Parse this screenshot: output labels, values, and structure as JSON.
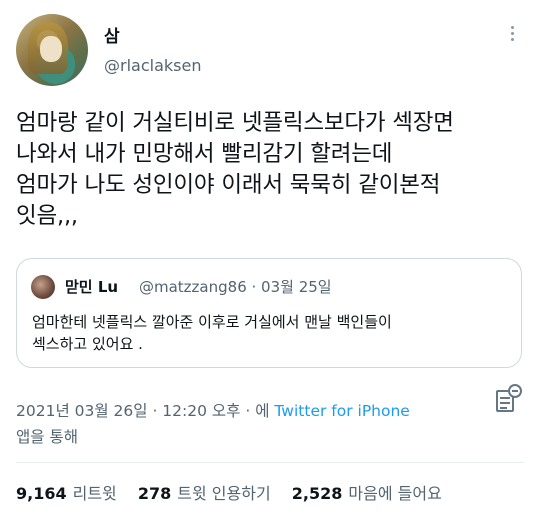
{
  "author": {
    "name": "삼",
    "handle": "@rlaclaksen"
  },
  "tweet": {
    "text": "엄마랑 같이 거실티비로 넷플릭스보다가 섹장면\n나와서 내가 민망해서 빨리감기 할려는데\n엄마가 나도 성인이야 이래서 묵묵히 같이본적\n잇음,,,"
  },
  "quoted": {
    "name": "맏민 Lu",
    "handle_date": "@matzzang86 · 03월 25일",
    "text": "엄마한테 넷플릭스 깔아준 이후로 거실에서 맨날 백인들이\n섹스하고 있어요 ."
  },
  "meta": {
    "timestamp": "2021년 03월 26일 · 12:20 오후 · 에 ",
    "source": "Twitter for iPhone",
    "source_suffix": "앱을 통해"
  },
  "stats": {
    "retweets_count": "9,164",
    "retweets_label": "리트윗",
    "quotes_count": "278",
    "quotes_label": "트윗 인용하기",
    "likes_count": "2,528",
    "likes_label": "마음에 들어요"
  },
  "icons": [
    "more-icon",
    "analytics-icon"
  ],
  "colors": {
    "link": "#1d9bf0",
    "secondary_text": "#536471"
  }
}
